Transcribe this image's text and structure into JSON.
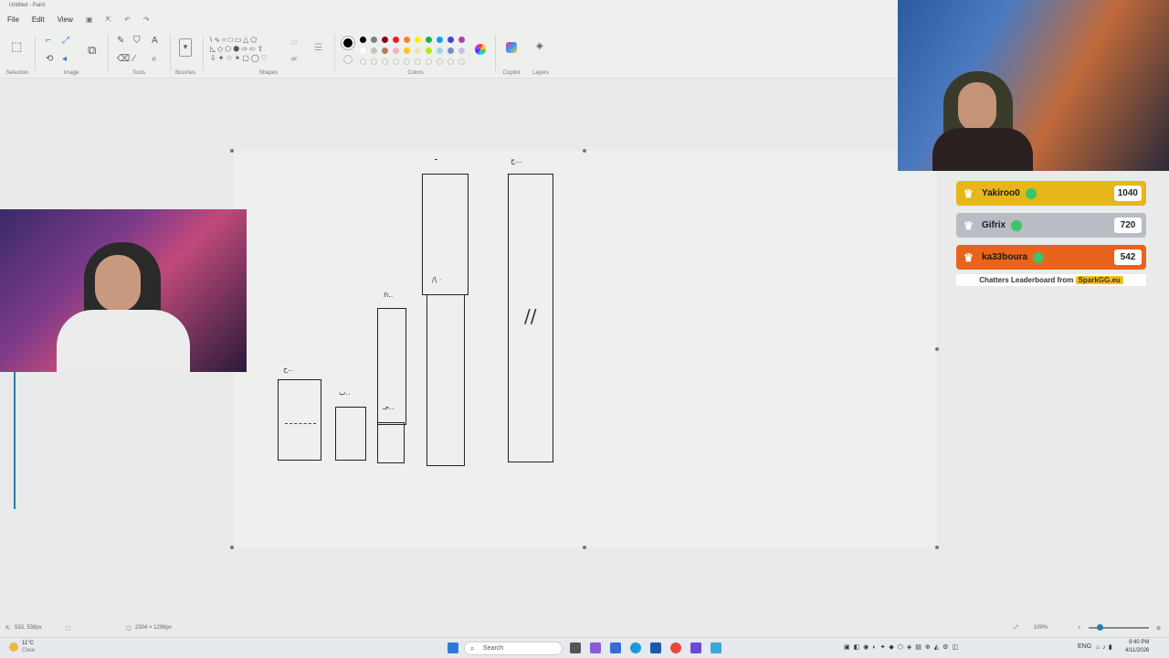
{
  "window": {
    "title": "Untitled - Paint"
  },
  "menu": {
    "file": "File",
    "edit": "Edit",
    "view": "View"
  },
  "ribbon": {
    "groups": {
      "selection": "Selection",
      "image": "Image",
      "tools": "Tools",
      "brushes": "Brushes",
      "shapes": "Shapes",
      "colors": "Colors",
      "copilot": "Copilot",
      "layers": "Layers"
    },
    "colors_row1": [
      "#000000",
      "#7f7f7f",
      "#880015",
      "#ed1c24",
      "#ff7f27",
      "#fff200",
      "#22b14c",
      "#00a2e8",
      "#3f48cc",
      "#a349a4"
    ],
    "colors_row2": [
      "#ffffff",
      "#c3c3c3",
      "#b97a57",
      "#ffaec9",
      "#ffc90e",
      "#efe4b0",
      "#b5e61d",
      "#99d9ea",
      "#7092be",
      "#c8bfe7"
    ],
    "active_color": "#000000"
  },
  "canvas": {
    "drawing_marks": [
      "ح..",
      "ب..",
      "ת..",
      "ـ",
      "ج...",
      "حـ..",
      "/\\ ·",
      "//"
    ]
  },
  "status": {
    "cursor_pos": "533, 538px",
    "canvas_size": "2304 × 1296px",
    "zoom": "100%"
  },
  "taskbar": {
    "weather_temp": "11°C",
    "weather_desc": "Clear",
    "search_placeholder": "Search",
    "lang": "ENG",
    "time": "9:40 PM",
    "date": "4/11/2026"
  },
  "leaderboard": {
    "entries": [
      {
        "name": "Yakiroo0",
        "score": "1040",
        "color": "#e6b61a"
      },
      {
        "name": "Gifrix",
        "score": "720",
        "color": "#b8bcc4"
      },
      {
        "name": "ka33boura",
        "score": "542",
        "color": "#e8641c"
      }
    ],
    "footer_text": "Chatters Leaderboard from",
    "footer_brand": "SparkGG.eu"
  }
}
